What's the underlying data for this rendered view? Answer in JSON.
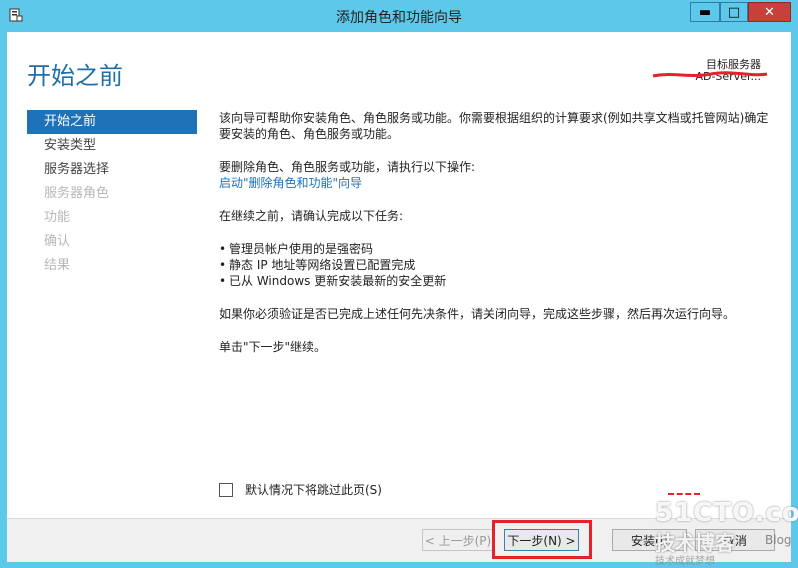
{
  "window": {
    "title": "添加角色和功能向导",
    "minimize": "▬",
    "maximize": "□",
    "close": "✕"
  },
  "header": {
    "heading": "开始之前",
    "target_label": "目标服务器",
    "target_value": "AD-Server..."
  },
  "nav": {
    "items": [
      {
        "label": "开始之前",
        "state": "active"
      },
      {
        "label": "安装类型",
        "state": "enabled"
      },
      {
        "label": "服务器选择",
        "state": "enabled"
      },
      {
        "label": "服务器角色",
        "state": "disabled"
      },
      {
        "label": "功能",
        "state": "disabled"
      },
      {
        "label": "确认",
        "state": "disabled"
      },
      {
        "label": "结果",
        "state": "disabled"
      }
    ]
  },
  "content": {
    "intro": "该向导可帮助你安装角色、角色服务或功能。你需要根据组织的计算要求(例如共享文档或托管网站)确定要安装的角色、角色服务或功能。",
    "remove_prompt": "要删除角色、角色服务或功能，请执行以下操作:",
    "remove_link": "启动\"删除角色和功能\"向导",
    "confirm_prompt": "在继续之前，请确认完成以下任务:",
    "tasks": [
      "管理员帐户使用的是强密码",
      "静态 IP 地址等网络设置已配置完成",
      "已从 Windows 更新安装最新的安全更新"
    ],
    "verify": "如果你必须验证是否已完成上述任何先决条件，请关闭向导，完成这些步骤，然后再次运行向导。",
    "continue": "单击\"下一步\"继续。"
  },
  "skip": {
    "label": "默认情况下将跳过此页(S)",
    "checked": false
  },
  "footer": {
    "prev": "< 上一步(P)",
    "next": "下一步(N) >",
    "install": "安装(I)",
    "cancel": "取消"
  },
  "watermark": {
    "brand": "51CTO.com",
    "sub": "技术博客",
    "blog": "Blog",
    "tag": "技术成就梦想"
  },
  "colors": {
    "accent": "#1e72b8",
    "frame": "#5ec8ea",
    "highlight": "#e5222a"
  }
}
